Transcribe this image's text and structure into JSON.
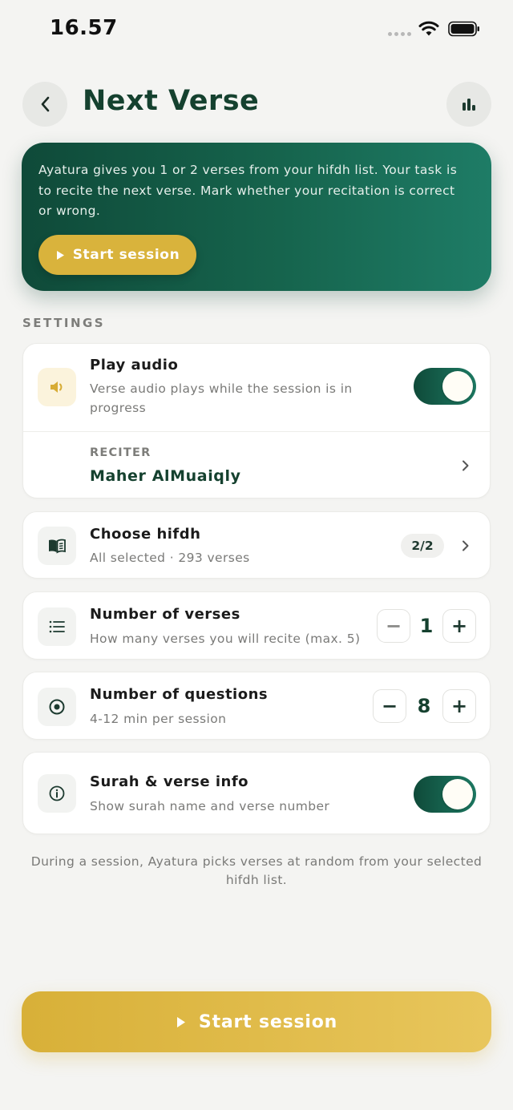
{
  "status": {
    "time": "16.57"
  },
  "header": {
    "title": "Next Verse"
  },
  "hero": {
    "text": "Ayatura gives you 1 or 2 verses from your hifdh list. Your task is to recite the next verse. Mark whether your recitation is correct or wrong.",
    "button_label": "Start session"
  },
  "settings": {
    "section_label": "SETTINGS",
    "play_audio": {
      "title": "Play audio",
      "subtitle": "Verse audio plays while the session is in progress",
      "enabled": true
    },
    "reciter": {
      "label": "RECITER",
      "value": "Maher AlMuaiqly"
    },
    "choose_hifdh": {
      "title": "Choose hifdh",
      "subtitle": "All selected · 293 verses",
      "badge": "2/2"
    },
    "num_verses": {
      "title": "Number of verses",
      "subtitle": "How many verses you will recite (max. 5)",
      "value": "1",
      "minus": "−",
      "plus": "+"
    },
    "num_questions": {
      "title": "Number of questions",
      "subtitle": "4-12 min per session",
      "value": "8",
      "minus": "−",
      "plus": "+"
    },
    "surah_info": {
      "title": "Surah & verse info",
      "subtitle": "Show surah name and verse number",
      "enabled": true
    }
  },
  "footnote": "During a session, Ayatura picks verses at random from your selected hifdh list.",
  "cta": {
    "label": "Start session"
  },
  "colors": {
    "primary": "#15412f",
    "accent": "#d9b33c",
    "background": "#f4f4f2"
  }
}
